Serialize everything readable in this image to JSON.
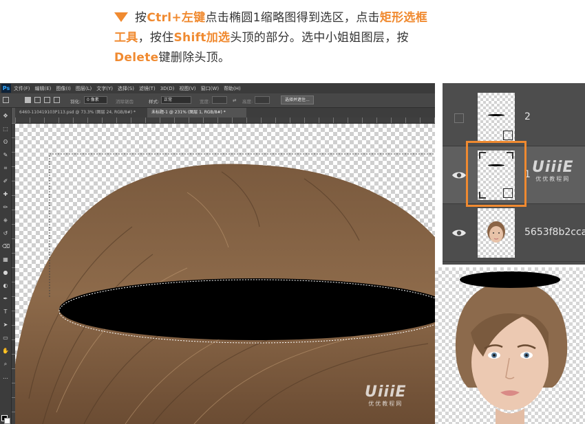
{
  "instruction": {
    "l1_a": "按",
    "l1_b": "Ctrl+左键",
    "l1_c": "点击椭圆1缩略图得到选区，点击",
    "l1_d": "矩形选框",
    "l2_a": "工具",
    "l2_b": "，按住",
    "l2_c": "Shift加选",
    "l2_d": "头顶的部分。选中小姐姐图层，按",
    "l3_a": "Delete",
    "l3_b": "键删除头顶。",
    "accent_color": "#f08a30"
  },
  "photoshop": {
    "logo": "Ps",
    "menu": [
      "文件(F)",
      "编辑(E)",
      "图像(I)",
      "图层(L)",
      "文字(Y)",
      "选择(S)",
      "滤镜(T)",
      "3D(D)",
      "视图(V)",
      "窗口(W)",
      "帮助(H)"
    ],
    "options": {
      "feather_label": "羽化:",
      "feather_value": "0 像素",
      "antialias_label": "消除锯齿",
      "style_label": "样式:",
      "style_value": "正常",
      "width_label": "宽度:",
      "height_label": "高度:",
      "select_mask_button": "选择并遮住..."
    },
    "tabs": [
      "6460-110419103P113.psd @ 73.3% (图层 24, RGB/8#) *",
      "未标题-1 @ 231% (图层 1, RGB/8#) *"
    ],
    "tools": [
      "move-icon",
      "marquee-icon",
      "lasso-icon",
      "quick-select-icon",
      "crop-icon",
      "eyedropper-icon",
      "healing-icon",
      "brush-icon",
      "stamp-icon",
      "history-brush-icon",
      "eraser-icon",
      "gradient-icon",
      "blur-icon",
      "dodge-icon",
      "pen-icon",
      "type-icon",
      "path-select-icon",
      "shape-icon",
      "hand-icon",
      "zoom-icon",
      "more-icon"
    ]
  },
  "layers": [
    {
      "name": "2",
      "visible": false,
      "selected": false
    },
    {
      "name": "1",
      "visible": true,
      "selected": true
    },
    {
      "name": "5653f8b2cca",
      "visible": true,
      "selected": false
    }
  ],
  "watermark": {
    "logo": "UiiiE",
    "site": "优优教程网"
  }
}
